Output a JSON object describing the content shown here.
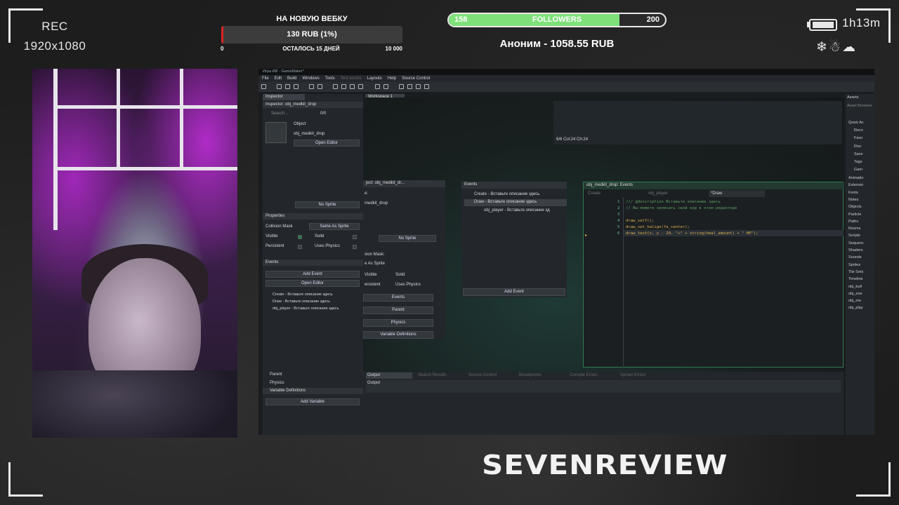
{
  "overlay": {
    "rec_label": "REC",
    "resolution": "1920x1080",
    "goal": {
      "title": "НА НОВУЮ ВЕБКУ",
      "amount": "130 RUB (1%)",
      "progress": 0.013,
      "min": "0",
      "remaining": "ОСТАЛОСЬ 15 ДНЕЙ",
      "max": "10 000",
      "fill_color": "#dd2222"
    },
    "followers": {
      "current": "158",
      "label": "FOLLOWERS",
      "target": "200",
      "progress": 0.79,
      "fill_color": "#7fe07a"
    },
    "last_donation": "Аноним - 1058.55 RUB",
    "session_time": "1h13m",
    "weather_icons": "❄☃☁",
    "brand": "SEVENREVIEW"
  },
  "gm": {
    "title": "Игра ИИ - GameMaker*",
    "menu": [
      "File",
      "Edit",
      "Build",
      "Windows",
      "Tools",
      "Test assets",
      "Layouts",
      "Help",
      "Source Control"
    ],
    "inspector": {
      "tab": "Inspector",
      "header": "Inspector: obj_medkit_drop",
      "search_placeholder": "Search...",
      "count": "0/0",
      "object_label": "Object",
      "object_name": "obj_medkit_drop",
      "open_editor": "Open Editor",
      "no_sprite": "No Sprite",
      "properties": "Properties",
      "collision_mask": "Collision Mask",
      "same_as_sprite": "Same As Sprite",
      "visible": "Visible",
      "solid": "Solid",
      "persistent": "Persistent",
      "uses_physics": "Uses Physics",
      "events": "Events",
      "add_event": "Add Event",
      "open_editor2": "Open Editor",
      "event_items": [
        "Create - Вставьте описание здесь",
        "Draw - Вставьте описание здесь",
        "obj_player - Вставьте описание здесь"
      ],
      "parent": "Parent",
      "physics": "Physics",
      "variable_definitions": "Variable Definitions",
      "add_variable": "Add Variable"
    },
    "workspace_tab": "Workspace 1",
    "top_status": "6/6 Col:24 Ch:24",
    "object_window": {
      "title": "ject: obj_medkit_dr...",
      "name_label": "e:",
      "name_value": "medkit_drop",
      "sprite": "No Sprite",
      "mask_label": "sion Mask:",
      "mask_value": "e As Sprite",
      "visible": "Visible",
      "solid": "Solid",
      "persistent": "ersistent",
      "uses_physics": "Uses Physics",
      "btn_events": "Events",
      "btn_parent": "Parent",
      "btn_physics": "Physics",
      "btn_vardefs": "Variable Definitions"
    },
    "events_window": {
      "title": "Events",
      "items": [
        "Create - Вставьте описание здесь",
        "Draw - Вставьте описание здесь",
        "obj_player - Вставьте описание зд"
      ],
      "add_event": "Add Event"
    },
    "code_window": {
      "title": "obj_medkit_drop: Events",
      "tabs": [
        "Create",
        "obj_player",
        "*Draw"
      ],
      "line_numbers": [
        "1",
        "2",
        "3",
        "4",
        "5",
        "6"
      ],
      "lines": [
        "/// @description Вставьте описание здесь",
        "// Вы можете записать свой код в этом редакторе",
        "",
        "draw_self();",
        "draw_set_halign(fa_center);",
        "draw_text(x, y - 20, \"+\" + string(heal_amount) + \" HP\");"
      ]
    },
    "output": {
      "tabs": [
        "Output",
        "Search Results",
        "Source Control",
        "Breakpoints",
        "Compile Errors",
        "Syntax Errors"
      ],
      "label": "Output"
    },
    "assets": {
      "tab": "Assets",
      "browser": "Asset Browser",
      "items": [
        "Quick Ac",
        "Reco",
        "Favo",
        "Roo",
        "Save",
        "Tags",
        "Gam",
        "Animatio",
        "Extensio",
        "Fonts",
        "Notes",
        "Objects",
        "Particle",
        "Paths",
        "Rooms",
        "Scripts",
        "Sequenc",
        "Shaders",
        "Sounds",
        "Sprites",
        "Tile Sets",
        "Timeline",
        "obj_bull",
        "obj_ene",
        "obj_me",
        "obj_play"
      ]
    }
  }
}
